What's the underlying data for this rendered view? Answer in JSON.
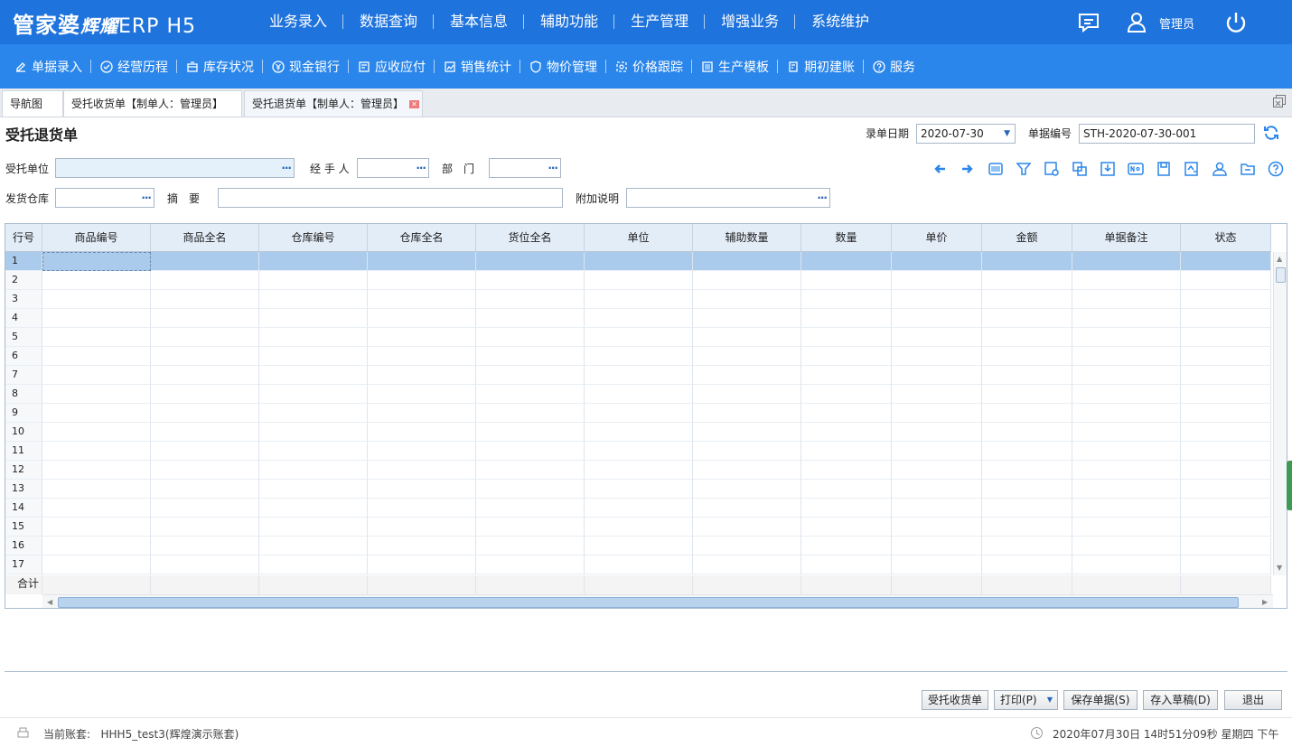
{
  "app": {
    "logo_main": "管家婆",
    "logo_brand": "辉耀",
    "logo_suffix": "ERP H5",
    "user": "管理员"
  },
  "main_menu": [
    "业务录入",
    "数据查询",
    "基本信息",
    "辅助功能",
    "生产管理",
    "增强业务",
    "系统维护"
  ],
  "sub_menu": [
    {
      "label": "单据录入",
      "icon": "edit-icon"
    },
    {
      "label": "经营历程",
      "icon": "check-circle-icon"
    },
    {
      "label": "库存状况",
      "icon": "box-icon"
    },
    {
      "label": "现金银行",
      "icon": "yen-icon"
    },
    {
      "label": "应收应付",
      "icon": "ledger-icon"
    },
    {
      "label": "销售统计",
      "icon": "chart-icon"
    },
    {
      "label": "物价管理",
      "icon": "shield-icon"
    },
    {
      "label": "价格跟踪",
      "icon": "target-icon"
    },
    {
      "label": "生产模板",
      "icon": "template-icon"
    },
    {
      "label": "期初建账",
      "icon": "book-icon"
    },
    {
      "label": "服务",
      "icon": "help-icon"
    }
  ],
  "tabs": [
    {
      "label": "导航图"
    },
    {
      "label": "受托收货单【制单人：管理员】"
    },
    {
      "label": "受托退货单【制单人：管理员】",
      "active": true
    }
  ],
  "form": {
    "title": "受托退货单",
    "date_label": "录单日期",
    "date_value": "2020-07-30",
    "number_label": "单据编号",
    "number_value": "STH-2020-07-30-001",
    "unit_label": "受托单位",
    "handler_label": "经 手 人",
    "dept_label": "部　门",
    "warehouse_label": "发货仓库",
    "summary_label": "摘　要",
    "note_label": "附加说明",
    "dots": "···"
  },
  "toolbar_icons": [
    "arrow-left-icon",
    "arrow-right-icon",
    "barcode-icon",
    "filter-icon",
    "settings-doc-icon",
    "copy-icon",
    "import-icon",
    "number-icon",
    "save-doc-icon",
    "batch-icon",
    "user-icon",
    "folder-icon",
    "help-icon"
  ],
  "grid": {
    "headers": [
      "行号",
      "商品编号",
      "商品全名",
      "仓库编号",
      "仓库全名",
      "货位全名",
      "单位",
      "辅助数量",
      "数量",
      "单价",
      "金额",
      "单据备注",
      "状态"
    ],
    "rows": [
      "1",
      "2",
      "3",
      "4",
      "5",
      "6",
      "7",
      "8",
      "9",
      "10",
      "11",
      "12",
      "13",
      "14",
      "15",
      "16",
      "17"
    ],
    "total_label": "合计"
  },
  "buttons": [
    "受托收货单",
    "打印(P)",
    "保存单据(S)",
    "存入草稿(D)",
    "退出"
  ],
  "status": {
    "account_label": "当前账套:",
    "account_value": "HHH5_test3(辉煌演示账套)",
    "datetime": "2020年07月30日 14时51分09秒 星期四 下午"
  }
}
